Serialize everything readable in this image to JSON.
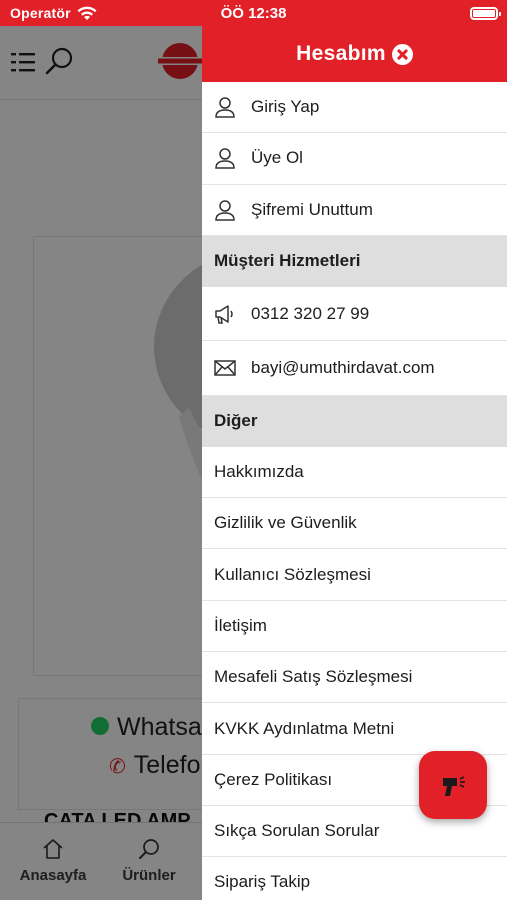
{
  "status_bar": {
    "carrier": "Operatör",
    "time": "ÖÖ 12:38"
  },
  "background": {
    "contact": {
      "whatsapp": "Whatsa",
      "phone": "Telefo"
    },
    "product_title": "CATA LED AMP",
    "tabs": [
      {
        "label": "Anasayfa",
        "icon": "home-icon"
      },
      {
        "label": "Ürünler",
        "icon": "search-icon"
      }
    ]
  },
  "drawer": {
    "title": "Hesabım",
    "account_items": [
      {
        "label": "Giriş Yap",
        "icon": "user-icon"
      },
      {
        "label": "Üye Ol",
        "icon": "user-icon"
      },
      {
        "label": "Şifremi Unuttum",
        "icon": "user-icon"
      }
    ],
    "customer_service": {
      "title": "Müşteri Hizmetleri",
      "phone": "0312 320 27 99",
      "email": "bayi@umuthirdavat.com"
    },
    "other": {
      "title": "Diğer",
      "items": [
        "Hakkımızda",
        "Gizlilik ve Güvenlik",
        "Kullanıcı Sözleşmesi",
        "İletişim",
        "Mesafeli Satış Sözleşmesi",
        "KVKK Aydınlatma Metni",
        "Çerez Politikası",
        "Sıkça Sorulan Sorular",
        "Sipariş Takip"
      ]
    }
  },
  "colors": {
    "brand": "#e22027",
    "section_bg": "#dedede"
  }
}
